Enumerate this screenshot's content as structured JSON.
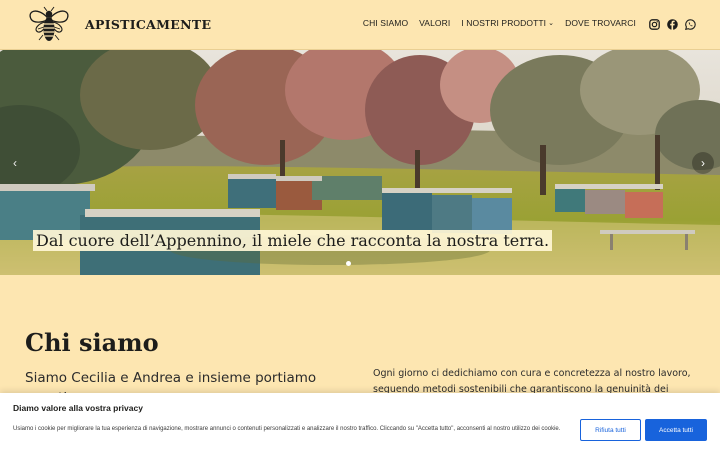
{
  "header": {
    "brand": "APISTICAMENTE",
    "nav": [
      {
        "label": "CHI SIAMO"
      },
      {
        "label": "VALORI"
      },
      {
        "label": "I NOSTRI PRODOTTI",
        "has_dropdown": true
      },
      {
        "label": "DOVE TROVARCI"
      }
    ],
    "social": [
      "instagram-icon",
      "facebook-icon",
      "whatsapp-icon"
    ]
  },
  "hero": {
    "caption": "Dal cuore dell’Appennino, il miele che racconta la nostra terra.",
    "slides": 1,
    "active_slide": 1
  },
  "section": {
    "title": "Chi siamo",
    "lead": "Siamo Cecilia e Andrea e insieme portiamo avanti",
    "body": "Ogni giorno ci dedichiamo con cura e concretezza al nostro lavoro, seguendo metodi sostenibili che garantiscono la genuinità dei prodotti: miele, polline,"
  },
  "cookie": {
    "title": "Diamo valore alla vostra privacy",
    "text": "Usiamo i cookie per migliorare la tua esperienza di navigazione, mostrare annunci o contenuti personalizzati e analizzare il nostro traffico. Cliccando su \"Accetta tutto\", acconsenti al nostro utilizzo dei cookie.",
    "reject_label": "Rifiuta tutti",
    "accept_label": "Accetta tutti"
  },
  "colors": {
    "background": "#fde6b1",
    "accent": "#1863dc",
    "text": "#1d1d1b"
  }
}
